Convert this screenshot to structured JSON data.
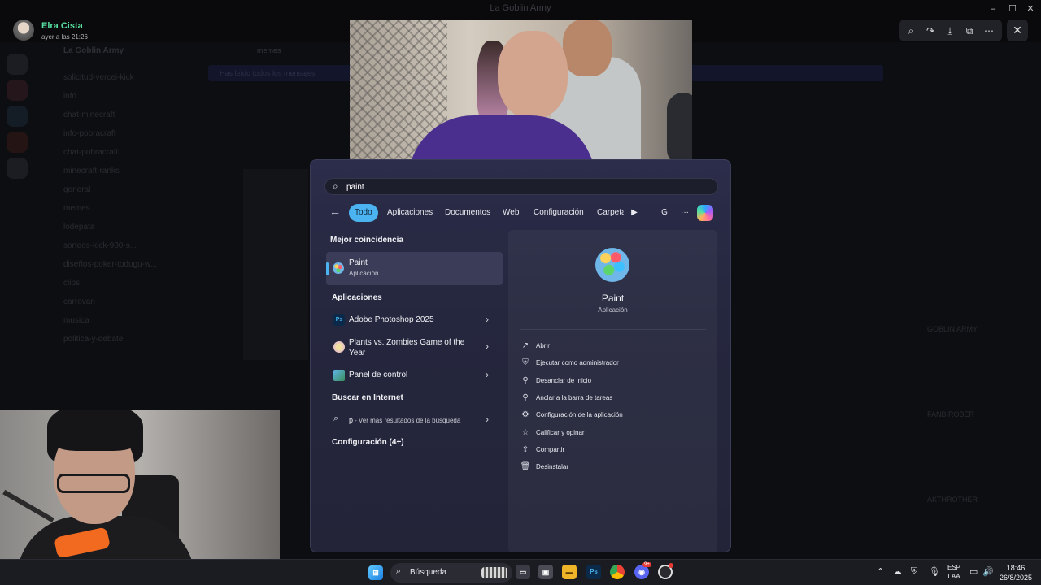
{
  "window": {
    "title": "La Goblin Army",
    "minimize": "–",
    "maximize": "☐",
    "close": "✕"
  },
  "viewer": {
    "poster_name": "Elra Cista",
    "poster_time": "ayer a las 21:26",
    "tools": [
      "zoom-icon",
      "forward-icon",
      "download-icon",
      "open-external-icon",
      "more-icon"
    ],
    "close_icon": "✕"
  },
  "discord_bg": {
    "server": "La Goblin Army",
    "channels": [
      "solicitud-vercei-kick",
      "info",
      "chat-minecraft",
      "info-pobracraft",
      "chat-pobracraft",
      "minecraft-ranks",
      "general",
      "memes",
      "lodepata",
      "sorteos-kick-900-s...",
      "diseños-poker-todugu-w...",
      "clips",
      "carrovan",
      "musica",
      "politica-y-debate"
    ],
    "channel_header": "memes",
    "banner": "Has leído todos los mensajes",
    "members": [
      "GOBLIN ARMY",
      "FANBIROBER",
      "AKTHROTHER"
    ]
  },
  "start_menu": {
    "search": {
      "value": "paint",
      "icon": "search-icon"
    },
    "back_icon": "←",
    "tabs": [
      "Todo",
      "Aplicaciones",
      "Documentos",
      "Web",
      "Configuración",
      "Carpeta"
    ],
    "extra": {
      "play": "▶",
      "account": "G",
      "more": "···"
    },
    "best_match_heading": "Mejor coincidencia",
    "best_match": {
      "title": "Paint",
      "subtitle": "Aplicación"
    },
    "apps_heading": "Aplicaciones",
    "apps": [
      {
        "title": "Adobe Photoshop 2025",
        "icon": "photoshop-icon"
      },
      {
        "title": "Plants vs. Zombies Game of the Year",
        "icon": "pvz-icon"
      },
      {
        "title": "Panel de control",
        "icon": "control-panel-icon"
      }
    ],
    "web_heading": "Buscar en Internet",
    "web_result": {
      "query": "p",
      "suffix": " - Ver más resultados de la búsqueda"
    },
    "settings_heading": "Configuración (4+)",
    "preview": {
      "title": "Paint",
      "subtitle": "Aplicación",
      "actions": [
        {
          "label": "Abrir",
          "icon": "↗"
        },
        {
          "label": "Ejecutar como administrador",
          "icon": "⛨"
        },
        {
          "label": "Desanclar de Inicio",
          "icon": "⚲"
        },
        {
          "label": "Anclar a la barra de tareas",
          "icon": "⚲"
        },
        {
          "label": "Configuración de la aplicación",
          "icon": "⚙"
        },
        {
          "label": "Calificar y opinar",
          "icon": "☆"
        },
        {
          "label": "Compartir",
          "icon": "⇪"
        },
        {
          "label": "Desinstalar",
          "icon": "🗑"
        }
      ]
    }
  },
  "taskbar": {
    "search_label": "Búsqueda",
    "apps": [
      "start-icon",
      "task-view-icon",
      "store-icon",
      "file-explorer-icon",
      "photoshop-icon",
      "chrome-icon",
      "discord-icon",
      "obs-icon"
    ],
    "discord_badge": "9+",
    "lang_top": "ESP",
    "lang_bottom": "LAA",
    "time": "18:46",
    "date": "26/8/2025"
  }
}
